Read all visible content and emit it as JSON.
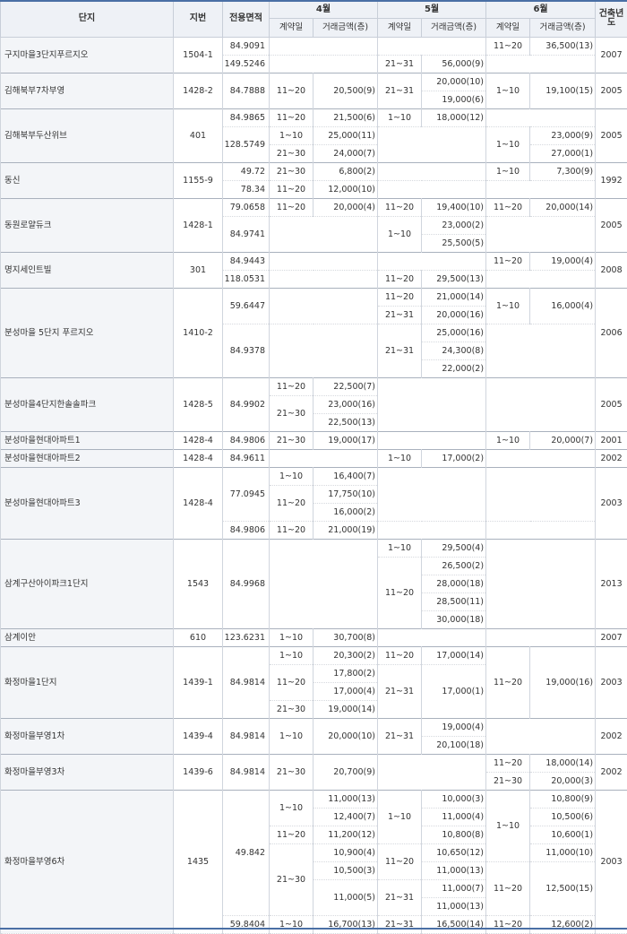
{
  "headers": {
    "complex": "단지",
    "lot": "지번",
    "area": "전용면적",
    "build": "건축년도",
    "months": [
      "4월",
      "5월",
      "6월"
    ],
    "contract_day": "계약일",
    "amount": "거래금액(층)"
  },
  "groups": [
    {
      "name": "구지마을3단지푸르지오",
      "lot": "1504-1",
      "year": "2007",
      "rows": [
        {
          "area": "84.9091",
          "m4": [],
          "m5": [],
          "m6": [
            {
              "d": "11~20",
              "p": "36,500",
              "f": "(13)"
            }
          ]
        },
        {
          "area": "149.5246",
          "m4": [],
          "m5": [
            {
              "d": "21~31",
              "p": "56,000",
              "f": "(9)"
            }
          ],
          "m6": []
        }
      ]
    },
    {
      "name": "김해북부7차부영",
      "lot": "1428-2",
      "year": "2005",
      "rows": [
        {
          "area": "84.7888",
          "m4": [
            {
              "d": "11~20",
              "p": "20,500",
              "f": "(9)"
            }
          ],
          "m5": [
            {
              "d": "21~31",
              "p": "20,000",
              "f": "(10)"
            },
            {
              "d": "",
              "p": "19,000",
              "f": "(6)"
            }
          ],
          "m6": [
            {
              "d": "1~10",
              "p": "19,100",
              "f": "(15)"
            }
          ]
        }
      ]
    },
    {
      "name": "김해북부두산위브",
      "lot": "401",
      "year": "2005",
      "rows": [
        {
          "area": "84.9865",
          "m4": [
            {
              "d": "11~20",
              "p": "21,500",
              "f": "(6)"
            }
          ],
          "m5": [
            {
              "d": "1~10",
              "p": "18,000",
              "f": "(12)"
            }
          ],
          "m6": []
        },
        {
          "area": "128.5749",
          "m4": [
            {
              "d": "1~10",
              "p": "25,000",
              "f": "(11)"
            },
            {
              "d": "21~30",
              "p": "24,000",
              "f": "(7)"
            }
          ],
          "m5": [],
          "m6": [
            {
              "d": "1~10",
              "p": "23,000",
              "f": "(9)"
            },
            {
              "d": "",
              "p": "27,000",
              "f": "(1)"
            }
          ]
        }
      ]
    },
    {
      "name": "동신",
      "lot": "1155-9",
      "year": "1992",
      "rows": [
        {
          "area": "49.72",
          "m4": [
            {
              "d": "21~30",
              "p": "6,800",
              "f": "(2)"
            }
          ],
          "m5": [],
          "m6": [
            {
              "d": "1~10",
              "p": "7,300",
              "f": "(9)"
            }
          ]
        },
        {
          "area": "78.34",
          "m4": [
            {
              "d": "11~20",
              "p": "12,000",
              "f": "(10)"
            }
          ],
          "m5": [],
          "m6": []
        }
      ]
    },
    {
      "name": "동원로얄듀크",
      "lot": "1428-1",
      "year": "2005",
      "rows": [
        {
          "area": "79.0658",
          "m4": [
            {
              "d": "11~20",
              "p": "20,000",
              "f": "(4)"
            }
          ],
          "m5": [
            {
              "d": "11~20",
              "p": "19,400",
              "f": "(10)"
            }
          ],
          "m6": [
            {
              "d": "11~20",
              "p": "20,000",
              "f": "(14)"
            }
          ]
        },
        {
          "area": "84.9741",
          "m4": [],
          "m5": [
            {
              "d": "1~10",
              "p": "23,000",
              "f": "(2)"
            },
            {
              "d": "",
              "p": "25,500",
              "f": "(5)"
            }
          ],
          "m6": []
        }
      ]
    },
    {
      "name": "명지세인트빌",
      "lot": "301",
      "year": "2008",
      "rows": [
        {
          "area": "84.9443",
          "m4": [],
          "m5": [],
          "m6": [
            {
              "d": "11~20",
              "p": "19,000",
              "f": "(4)"
            }
          ]
        },
        {
          "area": "118.0531",
          "m4": [],
          "m5": [
            {
              "d": "11~20",
              "p": "29,500",
              "f": "(13)"
            }
          ],
          "m6": []
        }
      ]
    },
    {
      "name": "분성마을 5단지 푸르지오",
      "lot": "1410-2",
      "year": "2006",
      "rows": [
        {
          "area": "59.6447",
          "m4": [],
          "m5": [
            {
              "d": "11~20",
              "p": "21,000",
              "f": "(14)"
            },
            {
              "d": "21~31",
              "p": "20,000",
              "f": "(16)"
            }
          ],
          "m6": [
            {
              "d": "1~10",
              "p": "16,000",
              "f": "(4)"
            }
          ]
        },
        {
          "area": "84.9378",
          "m4": [],
          "m5": [
            {
              "d": "21~31",
              "p": "25,000",
              "f": "(16)"
            },
            {
              "d": "",
              "p": "24,300",
              "f": "(8)"
            },
            {
              "d": "",
              "p": "22,000",
              "f": "(2)"
            }
          ],
          "m6": []
        }
      ]
    },
    {
      "name": "분성마을4단지한솔솔파크",
      "lot": "1428-5",
      "year": "2005",
      "rows": [
        {
          "area": "84.9902",
          "m4": [
            {
              "d": "11~20",
              "p": "22,500",
              "f": "(7)"
            },
            {
              "d": "21~30",
              "p": "23,000",
              "f": "(16)"
            },
            {
              "d": "",
              "p": "22,500",
              "f": "(13)"
            }
          ],
          "m5": [],
          "m6": []
        }
      ]
    },
    {
      "name": "분성마을현대아파트1",
      "lot": "1428-4",
      "year": "2001",
      "rows": [
        {
          "area": "84.9806",
          "m4": [
            {
              "d": "21~30",
              "p": "19,000",
              "f": "(17)"
            }
          ],
          "m5": [],
          "m6": [
            {
              "d": "1~10",
              "p": "20,000",
              "f": "(7)"
            }
          ]
        }
      ]
    },
    {
      "name": "분성마을현대아파트2",
      "lot": "1428-4",
      "year": "2002",
      "rows": [
        {
          "area": "84.9611",
          "m4": [],
          "m5": [
            {
              "d": "1~10",
              "p": "17,000",
              "f": "(2)"
            }
          ],
          "m6": []
        }
      ]
    },
    {
      "name": "분성마을현대아파트3",
      "lot": "1428-4",
      "year": "2003",
      "rows": [
        {
          "area": "77.0945",
          "m4": [
            {
              "d": "1~10",
              "p": "16,400",
              "f": "(7)"
            },
            {
              "d": "11~20",
              "p": "17,750",
              "f": "(10)"
            },
            {
              "d": "",
              "p": "16,000",
              "f": "(2)"
            }
          ],
          "m5": [],
          "m6": []
        },
        {
          "area": "84.9806",
          "m4": [
            {
              "d": "11~20",
              "p": "21,000",
              "f": "(19)"
            }
          ],
          "m5": [],
          "m6": []
        }
      ]
    },
    {
      "name": "삼계구산아이파크1단지",
      "lot": "1543",
      "year": "2013",
      "rows": [
        {
          "area": "84.9968",
          "m4": [],
          "m5": [
            {
              "d": "1~10",
              "p": "29,500",
              "f": "(4)"
            },
            {
              "d": "11~20",
              "p": "26,500",
              "f": "(2)"
            },
            {
              "d": "",
              "p": "28,000",
              "f": "(18)"
            },
            {
              "d": "",
              "p": "28,500",
              "f": "(11)"
            },
            {
              "d": "",
              "p": "30,000",
              "f": "(18)"
            }
          ],
          "m6": []
        }
      ]
    },
    {
      "name": "삼계이안",
      "lot": "610",
      "year": "2007",
      "rows": [
        {
          "area": "123.6231",
          "m4": [
            {
              "d": "1~10",
              "p": "30,700",
              "f": "(8)"
            }
          ],
          "m5": [],
          "m6": []
        }
      ]
    },
    {
      "name": "화정마을1단지",
      "lot": "1439-1",
      "year": "2003",
      "rows": [
        {
          "area": "84.9814",
          "m4": [
            {
              "d": "1~10",
              "p": "20,300",
              "f": "(2)"
            },
            {
              "d": "11~20",
              "p": "17,800",
              "f": "(2)"
            },
            {
              "d": "",
              "p": "17,000",
              "f": "(4)"
            },
            {
              "d": "21~30",
              "p": "19,000",
              "f": "(14)"
            }
          ],
          "m5": [
            {
              "d": "11~20",
              "p": "17,000",
              "f": "(14)"
            },
            {
              "d": "21~31",
              "p": "17,000",
              "f": "(1)"
            }
          ],
          "m6": [
            {
              "d": "11~20",
              "p": "19,000",
              "f": "(16)"
            }
          ]
        }
      ]
    },
    {
      "name": "화정마을부영1차",
      "lot": "1439-4",
      "year": "2002",
      "rows": [
        {
          "area": "84.9814",
          "m4": [
            {
              "d": "1~10",
              "p": "20,000",
              "f": "(10)"
            }
          ],
          "m5": [
            {
              "d": "21~31",
              "p": "19,000",
              "f": "(4)"
            },
            {
              "d": "",
              "p": "20,100",
              "f": "(18)"
            }
          ],
          "m6": []
        }
      ]
    },
    {
      "name": "화정마을부영3차",
      "lot": "1439-6",
      "year": "2002",
      "rows": [
        {
          "area": "84.9814",
          "m4": [
            {
              "d": "21~30",
              "p": "20,700",
              "f": "(9)"
            }
          ],
          "m5": [],
          "m6": [
            {
              "d": "11~20",
              "p": "18,000",
              "f": "(14)"
            },
            {
              "d": "21~30",
              "p": "20,000",
              "f": "(3)"
            }
          ]
        }
      ]
    },
    {
      "name": "화정마을부영6차",
      "lot": "1435",
      "year": "2003",
      "rows": [
        {
          "area": "49.842",
          "m4": [
            {
              "d": "1~10",
              "p": "11,000",
              "f": "(13)"
            },
            {
              "d": "",
              "p": "12,400",
              "f": "(7)"
            },
            {
              "d": "11~20",
              "p": "11,200",
              "f": "(12)"
            },
            {
              "d": "21~30",
              "p": "10,900",
              "f": "(4)"
            },
            {
              "d": "",
              "p": "10,500",
              "f": "(3)"
            },
            {
              "d": "",
              "p": "11,000",
              "f": "(5)"
            }
          ],
          "m5": [
            {
              "d": "1~10",
              "p": "10,000",
              "f": "(3)"
            },
            {
              "d": "",
              "p": "11,000",
              "f": "(4)"
            },
            {
              "d": "",
              "p": "10,800",
              "f": "(8)"
            },
            {
              "d": "11~20",
              "p": "10,650",
              "f": "(12)"
            },
            {
              "d": "",
              "p": "11,000",
              "f": "(13)"
            },
            {
              "d": "21~31",
              "p": "11,000",
              "f": "(7)"
            },
            {
              "d": "",
              "p": "11,000",
              "f": "(13)"
            }
          ],
          "m6": [
            {
              "d": "1~10",
              "p": "10,800",
              "f": "(9)"
            },
            {
              "d": "",
              "p": "10,500",
              "f": "(6)"
            },
            {
              "d": "",
              "p": "10,600",
              "f": "(1)"
            },
            {
              "d": "",
              "p": "11,000",
              "f": "(10)"
            },
            {
              "d": "11~20",
              "p": "12,500",
              "f": "(15)"
            }
          ]
        },
        {
          "area": "59.8404",
          "m4": [
            {
              "d": "1~10",
              "p": "16,700",
              "f": "(13)"
            }
          ],
          "m5": [
            {
              "d": "21~31",
              "p": "16,500",
              "f": "(14)"
            }
          ],
          "m6": [
            {
              "d": "11~20",
              "p": "12,600",
              "f": "(2)"
            }
          ]
        }
      ]
    }
  ]
}
